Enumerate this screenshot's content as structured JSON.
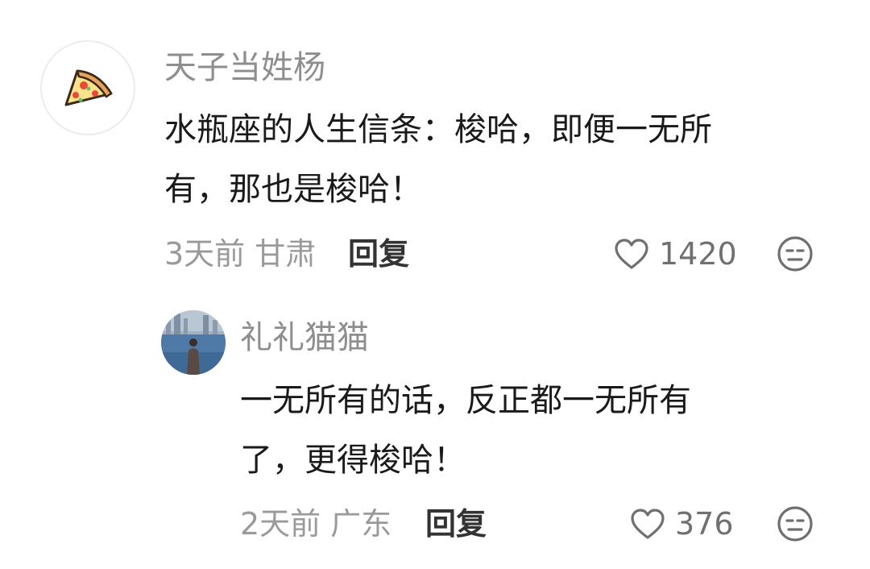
{
  "comments": [
    {
      "username": "天子当姓杨",
      "content_lines": [
        "水瓶座的人生信条：梭哈，即便一无所",
        "有，那也是梭哈！"
      ],
      "time": "3天前",
      "location": "甘肃",
      "reply_label": "回复",
      "likes": "1420",
      "avatar_icon": "pizza-icon"
    },
    {
      "username": "礼礼猫猫",
      "content_lines": [
        "一无所有的话，反正都一无所有",
        "了，更得梭哈！"
      ],
      "time": "2天前",
      "location": "广东",
      "reply_label": "回复",
      "likes": "376",
      "avatar_icon": "photo-avatar"
    }
  ],
  "colors": {
    "username": "#8e8e8e",
    "content": "#1a1a1a",
    "meta": "#9a9a9a",
    "icon_stroke": "#6f6f6f"
  }
}
